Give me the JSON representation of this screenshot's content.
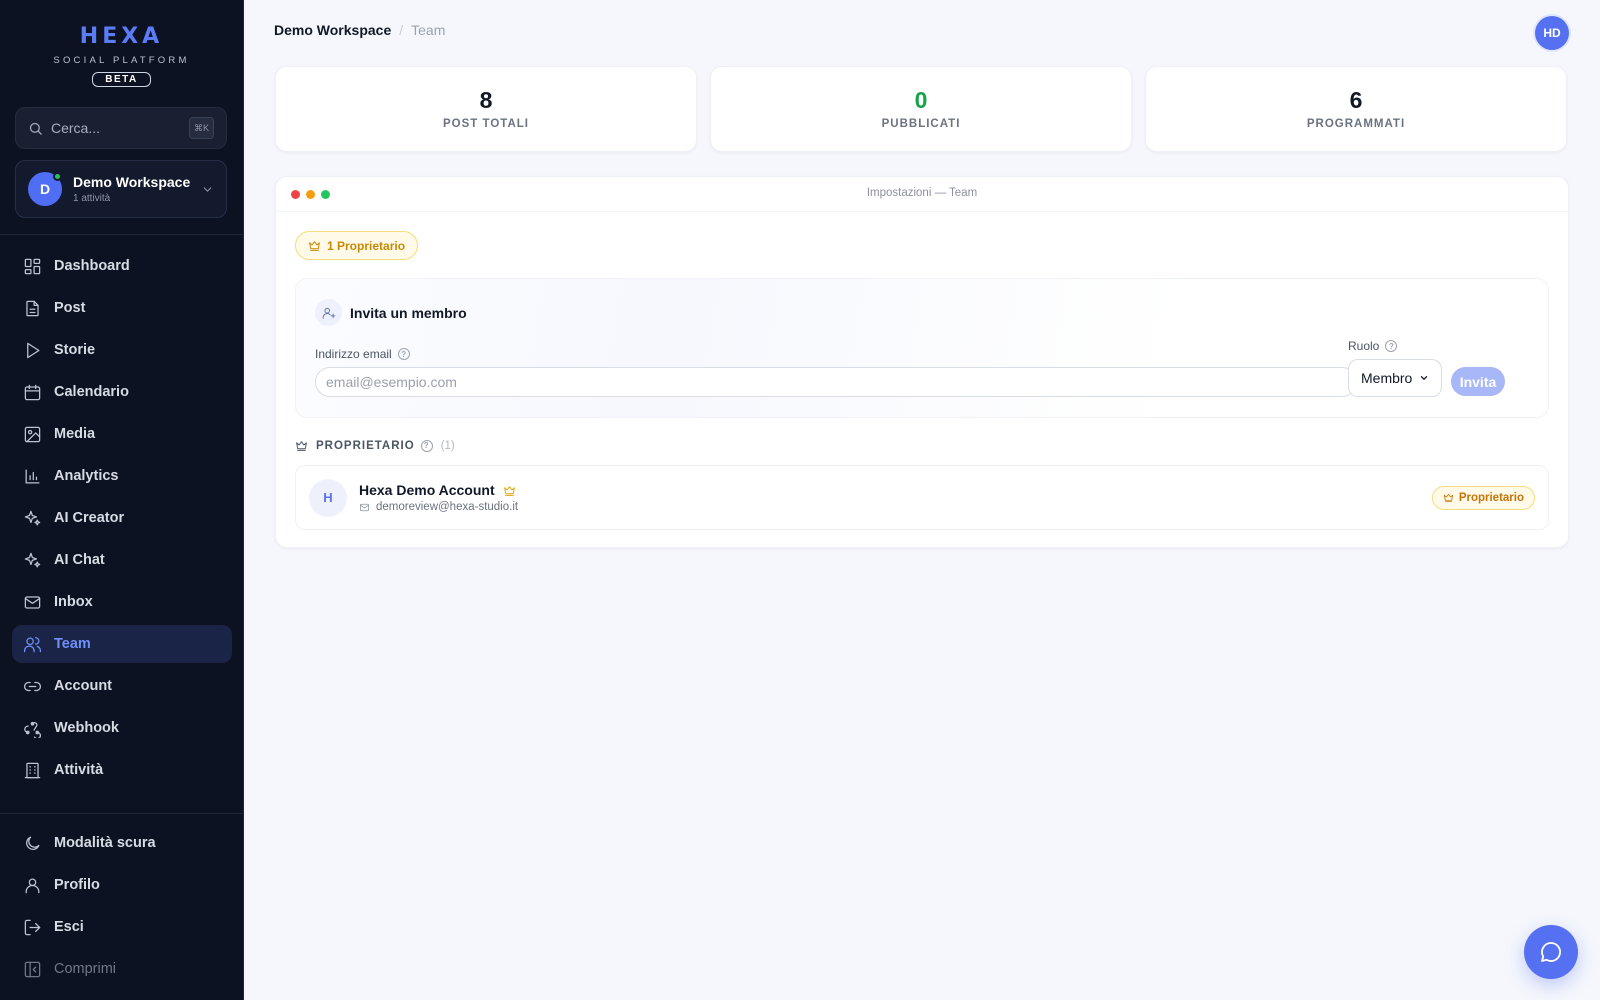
{
  "brand": {
    "logo": "HEXA",
    "subtitle": "SOCIAL PLATFORM",
    "badge": "BETA"
  },
  "search": {
    "placeholder": "Cerca...",
    "shortcut": "⌘K"
  },
  "workspace": {
    "initial": "D",
    "name": "Demo Workspace",
    "sub": "1 attività"
  },
  "sidebar": {
    "items": [
      {
        "label": "Dashboard",
        "icon": "grid-icon"
      },
      {
        "label": "Post",
        "icon": "file-icon"
      },
      {
        "label": "Storie",
        "icon": "play-icon"
      },
      {
        "label": "Calendario",
        "icon": "calendar-icon"
      },
      {
        "label": "Media",
        "icon": "image-icon"
      },
      {
        "label": "Analytics",
        "icon": "bar-chart-icon"
      },
      {
        "label": "AI Creator",
        "icon": "sparkles-icon"
      },
      {
        "label": "AI Chat",
        "icon": "sparkles-icon"
      },
      {
        "label": "Inbox",
        "icon": "mail-icon"
      },
      {
        "label": "Team",
        "icon": "users-icon",
        "active": true
      },
      {
        "label": "Account",
        "icon": "link-icon"
      },
      {
        "label": "Webhook",
        "icon": "webhook-icon"
      },
      {
        "label": "Attività",
        "icon": "building-icon"
      }
    ],
    "bottom": [
      {
        "label": "Modalità scura",
        "icon": "moon-icon"
      },
      {
        "label": "Profilo",
        "icon": "user-icon"
      },
      {
        "label": "Esci",
        "icon": "logout-icon"
      },
      {
        "label": "Comprimi",
        "icon": "collapse-icon"
      }
    ]
  },
  "header": {
    "breadcrumb_1": "Demo Workspace",
    "separator": "/",
    "breadcrumb_2": "Team",
    "user_initials": "HD"
  },
  "stats": [
    {
      "value": "8",
      "label": "POST TOTALI"
    },
    {
      "value": "0",
      "label": "PUBBLICATI"
    },
    {
      "value": "6",
      "label": "PROGRAMMATI"
    }
  ],
  "panel": {
    "title": "Impostazioni — Team",
    "owner_pill": "1 Proprietario",
    "invite": {
      "title": "Invita un membro",
      "email_label": "Indirizzo email",
      "email_placeholder": "email@esempio.com",
      "email_value": "",
      "role_label": "Ruolo",
      "role_value": "Membro",
      "button": "Invita"
    },
    "section": {
      "title": "PROPRIETARIO",
      "count": "(1)"
    },
    "member": {
      "initial": "H",
      "name": "Hexa Demo Account",
      "email": "demoreview@hexa-studio.it",
      "role_badge": "Proprietario"
    }
  },
  "colors": {
    "accent": "#5670f2",
    "sidebar_bg": "#0d1222",
    "owner_gold": "#c88a06",
    "published_green": "#16a34a"
  }
}
